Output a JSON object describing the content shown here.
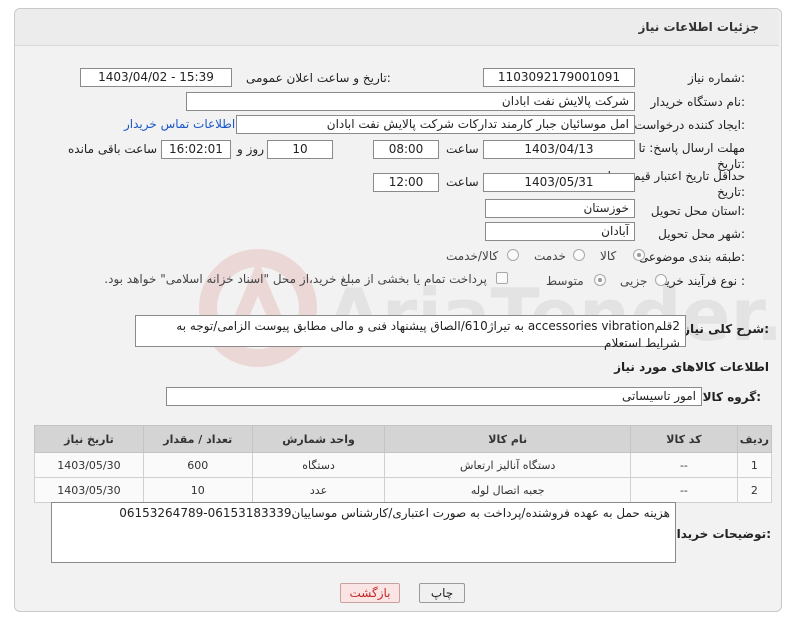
{
  "header": {
    "title": "جزئیات اطلاعات نیاز"
  },
  "fields": {
    "need_number_label": "شماره نیاز:",
    "need_number": "1103092179001091",
    "announce_label": "تاریخ و ساعت اعلان عمومی:",
    "announce_value": "1403/04/02 - 15:39",
    "buyer_org_label": "نام دستگاه خریدار:",
    "buyer_org": "شرکت پالایش نفت ابادان",
    "creator_label": "ایجاد کننده درخواست:",
    "creator": "امل موسائیان جبار کارمند تدارکات شرکت پالایش نفت ابادان",
    "contact_link": "اطلاعات تماس خریدار",
    "deadline_label": "مهلت ارسال پاسخ: تا تاریخ:",
    "deadline_date": "1403/04/13",
    "time_label": "ساعت",
    "deadline_time": "08:00",
    "days_value": "10",
    "days_label": "روز و",
    "remaining_time": "16:02:01",
    "remaining_label": "ساعت باقی مانده",
    "validity_label": "حداقل تاریخ اعتبار قیمت: تا تاریخ:",
    "validity_date": "1403/05/31",
    "validity_time": "12:00",
    "province_label": "استان محل تحویل:",
    "province": "خوزستان",
    "city_label": "شهر محل تحویل:",
    "city": "آبادان",
    "category_label": "طبقه بندی موضوعی:",
    "category_options": [
      "کالا",
      "خدمت",
      "کالا/خدمت"
    ],
    "process_label": "نوع فرآیند خرید :",
    "process_options": [
      "جزیی",
      "متوسط"
    ],
    "payment_note": "پرداخت تمام یا بخشی از مبلغ خرید،از محل \"اسناد خزانه اسلامی\" خواهد بود."
  },
  "description": {
    "label": "شرح کلی نیاز:",
    "text": "2قلمaccessories vibration به تیراژ610/الصاق پیشنهاد فنی و مالی مطابق پیوست الزامی/توجه به شرایط استعلام"
  },
  "goods": {
    "title": "اطلاعات کالاهای مورد نیاز",
    "group_label": "گروه کالا:",
    "group_value": "امور تاسیساتی",
    "columns": [
      "ردیف",
      "کد کالا",
      "نام کالا",
      "واحد شمارش",
      "تعداد / مقدار",
      "تاریخ نیاز"
    ],
    "rows": [
      [
        "1",
        "--",
        "دستگاه آنالیز ارتعاش",
        "دستگاه",
        "600",
        "1403/05/30"
      ],
      [
        "2",
        "--",
        "جعبه اتصال لوله",
        "عدد",
        "10",
        "1403/05/30"
      ]
    ]
  },
  "buyer_notes": {
    "label": "توضیحات خریدار:",
    "text": "هزینه حمل به عهده فروشنده/پرداخت به صورت اعتباری/کارشناس موساییان06153183339-06153264789"
  },
  "buttons": {
    "print": "چاپ",
    "back": "بازگشت"
  },
  "watermark": "AriaTender.neT"
}
